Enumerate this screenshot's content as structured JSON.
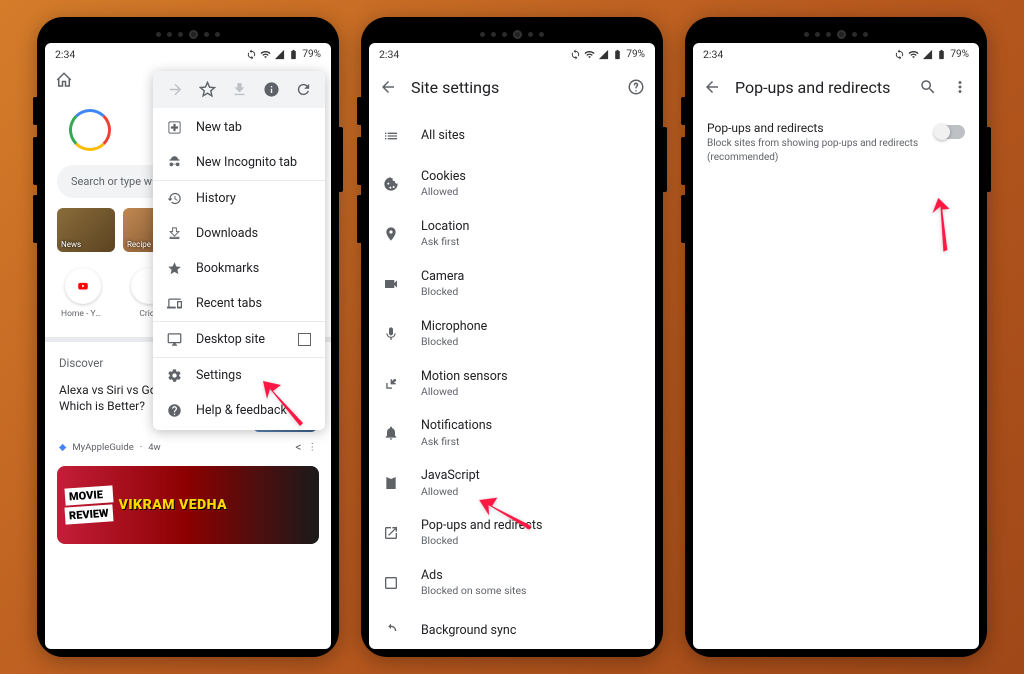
{
  "status": {
    "time": "2:34",
    "battery": "79%"
  },
  "phone1": {
    "search_placeholder": "Search or type w",
    "tiles": {
      "news": "News",
      "recipe": "Recipe"
    },
    "shortcuts": {
      "home": "Home - You…",
      "cricket": "Crick"
    },
    "discover": "Discover",
    "article": {
      "title": "Alexa vs Siri vs Google Assistant : Which is Better?",
      "source": "MyAppleGuide",
      "age": "4w"
    },
    "movie": {
      "line1": "MOVIE",
      "line2": "REVIEW",
      "title": "VIKRAM VEDHA"
    },
    "menu_toolbar": {
      "forward": "→",
      "star": "☆",
      "download": "↓",
      "info": "ⓘ",
      "reload": "⟳"
    },
    "menu_items": {
      "new_tab": "New tab",
      "incognito": "New Incognito tab",
      "history": "History",
      "downloads": "Downloads",
      "bookmarks": "Bookmarks",
      "recent": "Recent tabs",
      "desktop": "Desktop site",
      "settings": "Settings",
      "help": "Help & feedback"
    }
  },
  "phone2": {
    "title": "Site settings",
    "items": {
      "all_sites": {
        "label": "All sites"
      },
      "cookies": {
        "label": "Cookies",
        "sub": "Allowed"
      },
      "location": {
        "label": "Location",
        "sub": "Ask first"
      },
      "camera": {
        "label": "Camera",
        "sub": "Blocked"
      },
      "microphone": {
        "label": "Microphone",
        "sub": "Blocked"
      },
      "motion": {
        "label": "Motion sensors",
        "sub": "Allowed"
      },
      "notifications": {
        "label": "Notifications",
        "sub": "Ask first"
      },
      "javascript": {
        "label": "JavaScript",
        "sub": "Allowed"
      },
      "popups": {
        "label": "Pop-ups and redirects",
        "sub": "Blocked"
      },
      "ads": {
        "label": "Ads",
        "sub": "Blocked on some sites"
      },
      "bg_sync": {
        "label": "Background sync"
      }
    }
  },
  "phone3": {
    "title": "Pop-ups and redirects",
    "toggle": {
      "label": "Pop-ups and redirects",
      "sub": "Block sites from showing pop-ups and redirects (recommended)"
    }
  }
}
